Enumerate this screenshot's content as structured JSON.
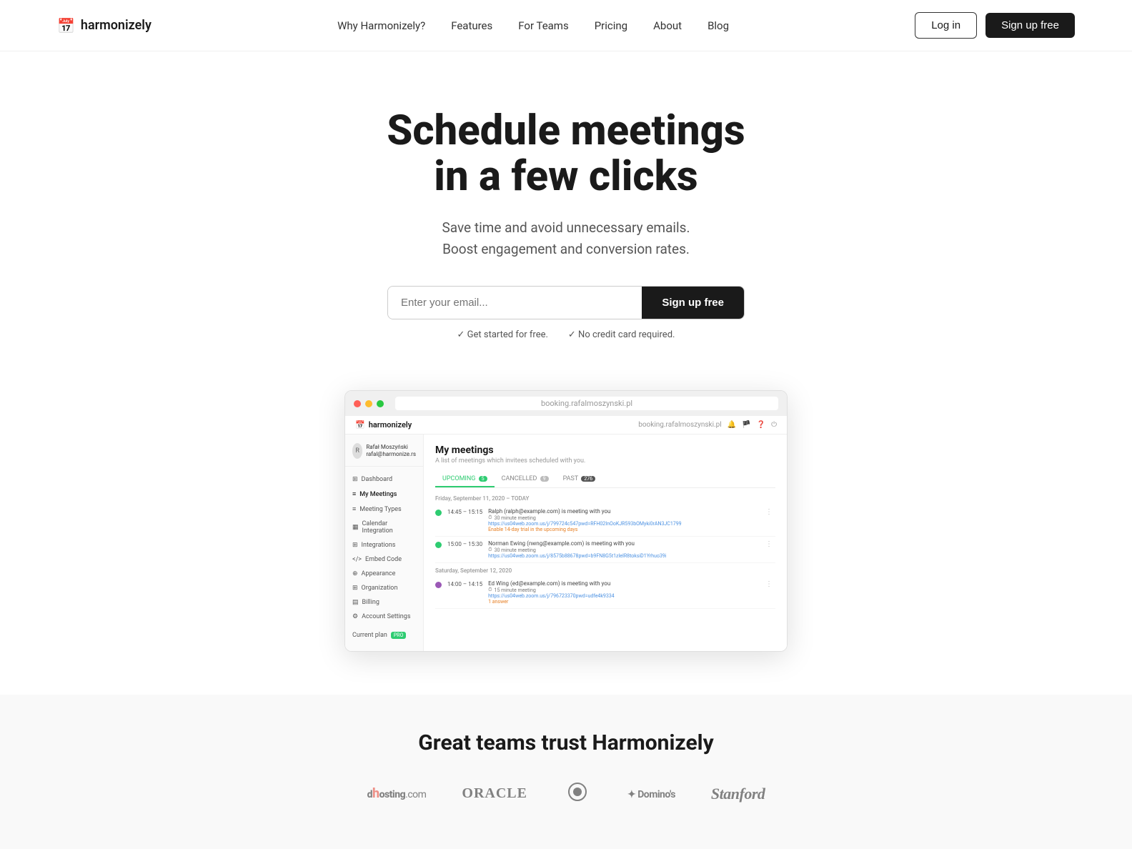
{
  "nav": {
    "logo_text": "harmonizely",
    "items": [
      {
        "label": "Why Harmonizely?",
        "id": "why"
      },
      {
        "label": "Features",
        "id": "features"
      },
      {
        "label": "For Teams",
        "id": "teams"
      },
      {
        "label": "Pricing",
        "id": "pricing"
      },
      {
        "label": "About",
        "id": "about"
      },
      {
        "label": "Blog",
        "id": "blog"
      }
    ],
    "login_label": "Log in",
    "signup_label": "Sign up free"
  },
  "hero": {
    "title_line1": "Schedule meetings",
    "title_line2": "in a few clicks",
    "subtitle_line1": "Save time and avoid unnecessary emails.",
    "subtitle_line2": "Boost engagement and conversion rates.",
    "email_placeholder": "Enter your email...",
    "signup_button": "Sign up free",
    "note1": "Get started for free.",
    "note2": "No credit card required."
  },
  "browser": {
    "url": "booking.rafalmoszynski.pl",
    "app_logo": "harmonizely",
    "user_name": "Rafał Moszyński",
    "user_email": "rafal@harmonize.rs"
  },
  "sidebar": {
    "items": [
      {
        "label": "Dashboard",
        "icon": "⊞",
        "active": false
      },
      {
        "label": "My Meetings",
        "icon": "≡",
        "active": true
      },
      {
        "label": "Meeting Types",
        "icon": "≡",
        "active": false
      },
      {
        "label": "Calendar Integration",
        "icon": "▦",
        "active": false
      },
      {
        "label": "Integrations",
        "icon": "⊞",
        "active": false
      },
      {
        "label": "Embed Code",
        "icon": "</>",
        "active": false
      },
      {
        "label": "Appearance",
        "icon": "⊕",
        "active": false
      },
      {
        "label": "Organization",
        "icon": "⊞",
        "active": false
      },
      {
        "label": "Billing",
        "icon": "▤",
        "active": false
      },
      {
        "label": "Account Settings",
        "icon": "⚙",
        "active": false
      }
    ],
    "plan_label": "Current plan",
    "plan_badge": "PRO"
  },
  "meetings": {
    "title": "My meetings",
    "subtitle": "A list of meetings which invitees scheduled with you.",
    "tabs": [
      {
        "label": "UPCOMING",
        "badge": "5",
        "active": true
      },
      {
        "label": "CANCELLED",
        "badge": "9",
        "active": false
      },
      {
        "label": "PAST",
        "badge": "276",
        "active": false
      }
    ],
    "date_groups": [
      {
        "date": "Friday, September 11, 2020 – TODAY",
        "meetings": [
          {
            "color": "#2ecc71",
            "time": "14:45 – 15:15",
            "person": "Ralph (ralph@example.com) is meeting with you",
            "type": "30 minute meeting",
            "link": "https://us04web.zoom.us/j/799724c547pwd=RFH02InOoKJR593bOMyki0rAN3JC1799",
            "note": "Enable 14-day trial in the upcoming days"
          },
          {
            "color": "#2ecc71",
            "time": "15:00 – 15:30",
            "person": "Norman Ewing (nwng@example.com) is meeting with you",
            "type": "30 minute meeting",
            "link": "https://us04web.zoom.us/j/8575b88678pwd=b9FN8G5t1zleIR8toksiD1Yrhuo39i",
            "note": null
          }
        ]
      },
      {
        "date": "Saturday, September 12, 2020",
        "meetings": [
          {
            "color": "#9b59b6",
            "time": "14:00 – 14:15",
            "person": "Ed Wing (ed@example.com) is meeting with you",
            "type": "15 minute meeting",
            "link": "https://us04web.zoom.us/j/796723370pwd=udfe4k9334",
            "note": "1 answer"
          }
        ]
      }
    ]
  },
  "trust": {
    "title": "Great teams trust Harmonizely",
    "logos": [
      {
        "name": "dhosting.com",
        "display": "dhosting.com"
      },
      {
        "name": "Oracle",
        "display": "ORACLE"
      },
      {
        "name": "Brand3",
        "display": "❦"
      },
      {
        "name": "Dominos",
        "display": "✦ Domino's"
      },
      {
        "name": "Stanford",
        "display": "Stanford"
      }
    ]
  }
}
